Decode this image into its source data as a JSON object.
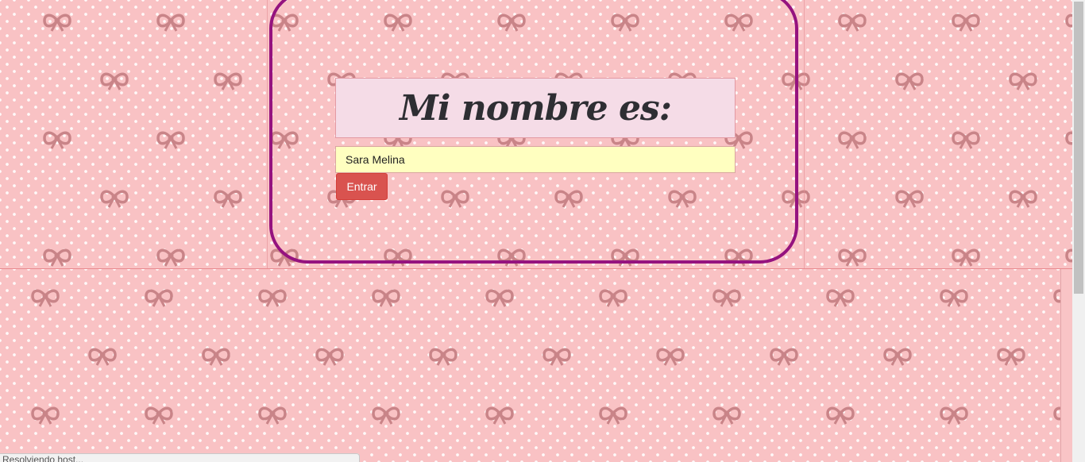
{
  "page": {
    "title": "Mi nombre es:",
    "name_input": {
      "value": "Sara Melina",
      "background_color": "#ffffc0"
    },
    "enter_button": {
      "label": "Entrar",
      "color": "#d9534f"
    },
    "frame_color": "#95137f",
    "background": {
      "color": "#f9c2c4",
      "pattern": "white polka dots with mauve bows"
    }
  },
  "status_bar": {
    "text": "Resolviendo host..."
  }
}
